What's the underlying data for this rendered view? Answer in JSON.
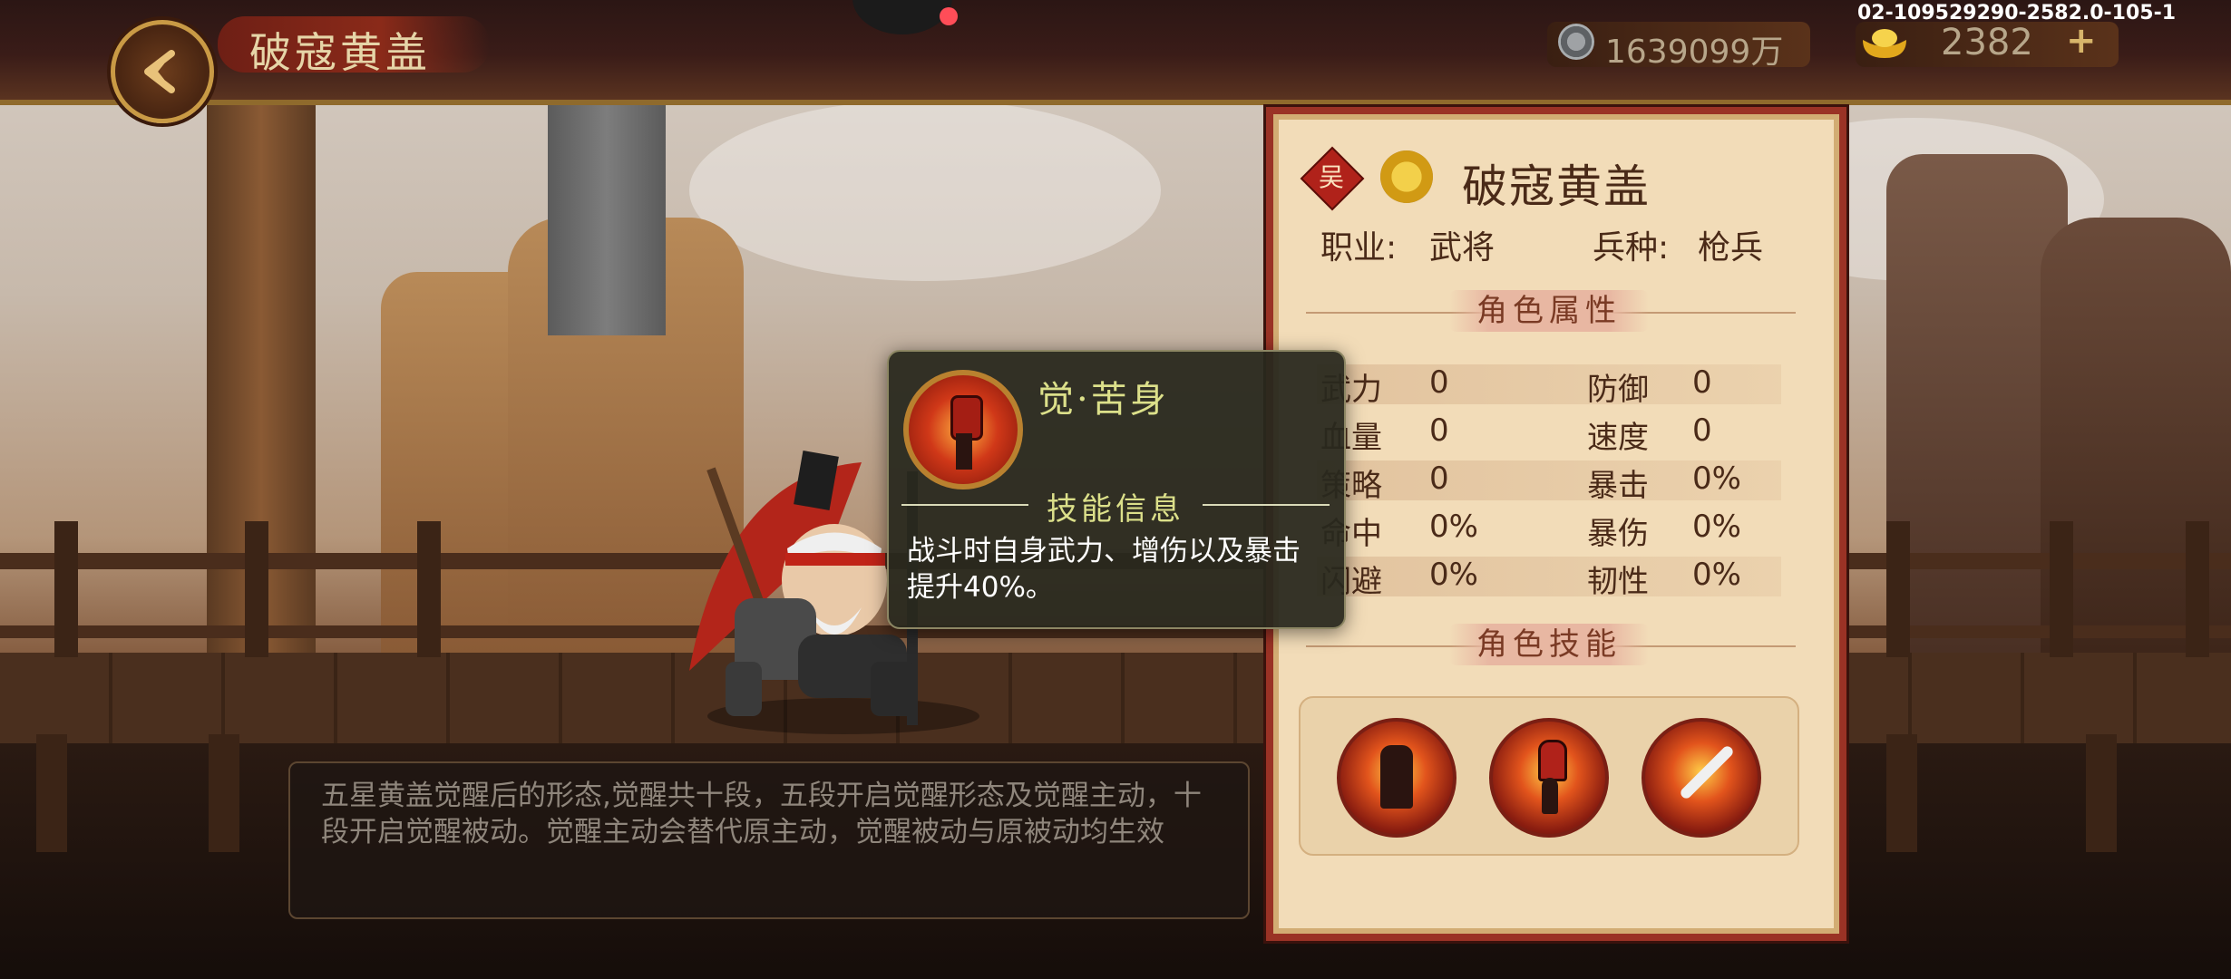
{
  "header": {
    "title": "破寇黄盖",
    "silver_amount": "1639099万",
    "gold_amount": "2382",
    "add_symbol": "+",
    "build_id": "02-109529290-2582.0-105-1"
  },
  "hero": {
    "faction_char": "吴",
    "name": "破寇黄盖",
    "profession_label": "职业:",
    "profession_value": "武将",
    "troop_label": "兵种:",
    "troop_value": "枪兵"
  },
  "attributes": {
    "section_title": "角色属性",
    "rows": [
      {
        "l_label": "武力",
        "l_value": "0",
        "r_label": "防御",
        "r_value": "0"
      },
      {
        "l_label": "血量",
        "l_value": "0",
        "r_label": "速度",
        "r_value": "0"
      },
      {
        "l_label": "策略",
        "l_value": "0",
        "r_label": "暴击",
        "r_value": "0%"
      },
      {
        "l_label": "命中",
        "l_value": "0%",
        "r_label": "暴伤",
        "r_value": "0%"
      },
      {
        "l_label": "闪避",
        "l_value": "0%",
        "r_label": "韧性",
        "r_value": "0%"
      }
    ]
  },
  "skills": {
    "section_title": "角色技能",
    "icons": [
      "warrior-skill-icon",
      "fist-skill-icon",
      "spear-skill-icon"
    ]
  },
  "tooltip": {
    "skill_name": "觉·苦身",
    "section_label": "技能信息",
    "description": "战斗时自身武力、增伤以及暴击提升40%。"
  },
  "description": "五星黄盖觉醒后的形态,觉醒共十段，五段开启觉醒形态及觉醒主动，十段开启觉醒被动。觉醒主动会替代原主动，觉醒被动与原被动均生效",
  "colors": {
    "panel_bg": "#f2dcb8",
    "panel_border": "#9a3225",
    "tooltip_accent": "#dce08a",
    "faction_red": "#b0221a"
  }
}
